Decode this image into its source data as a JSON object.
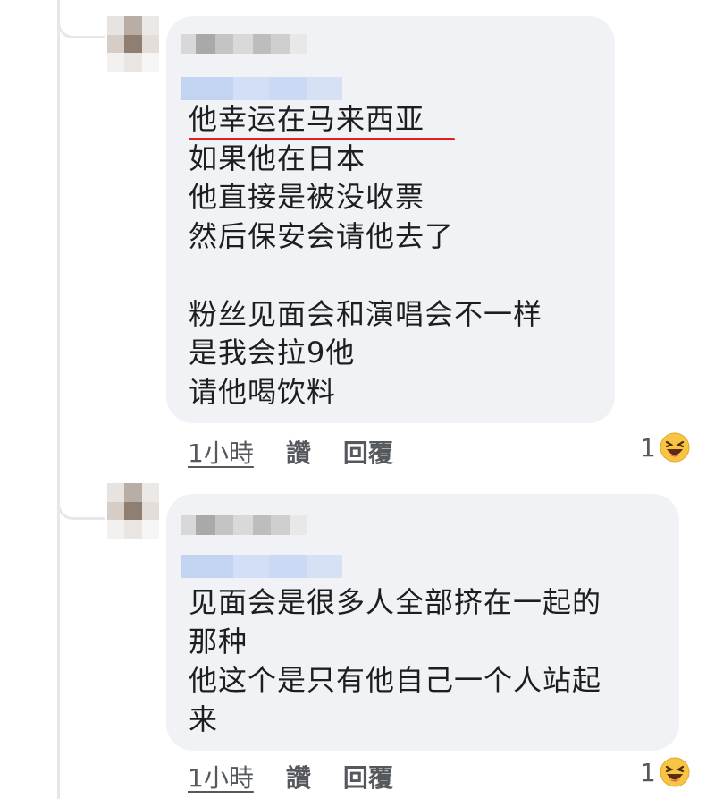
{
  "comments": [
    {
      "message": "他幸运在马来西亚\n如果他在日本\n他直接是被没收票\n然后保安会请他去了\n\n粉丝见面会和演唱会不一样\n是我会拉9他\n请他喝饮料",
      "time": "1小時",
      "like_label": "讚",
      "reply_label": "回覆",
      "reaction_count": "1",
      "reaction_icon": "laughing-emoji-icon"
    },
    {
      "message": "见面会是很多人全部挤在一起的\n那种\n他这个是只有他自己一个人站起\n来",
      "time": "1小時",
      "like_label": "讚",
      "reply_label": "回覆",
      "reaction_count": "1",
      "reaction_icon": "laughing-emoji-icon"
    }
  ],
  "colors": {
    "bubble": "#f0f2f5",
    "underline": "#e02020",
    "thread_line": "#e6e7ea",
    "blurred_link": "#c9d9f5"
  }
}
